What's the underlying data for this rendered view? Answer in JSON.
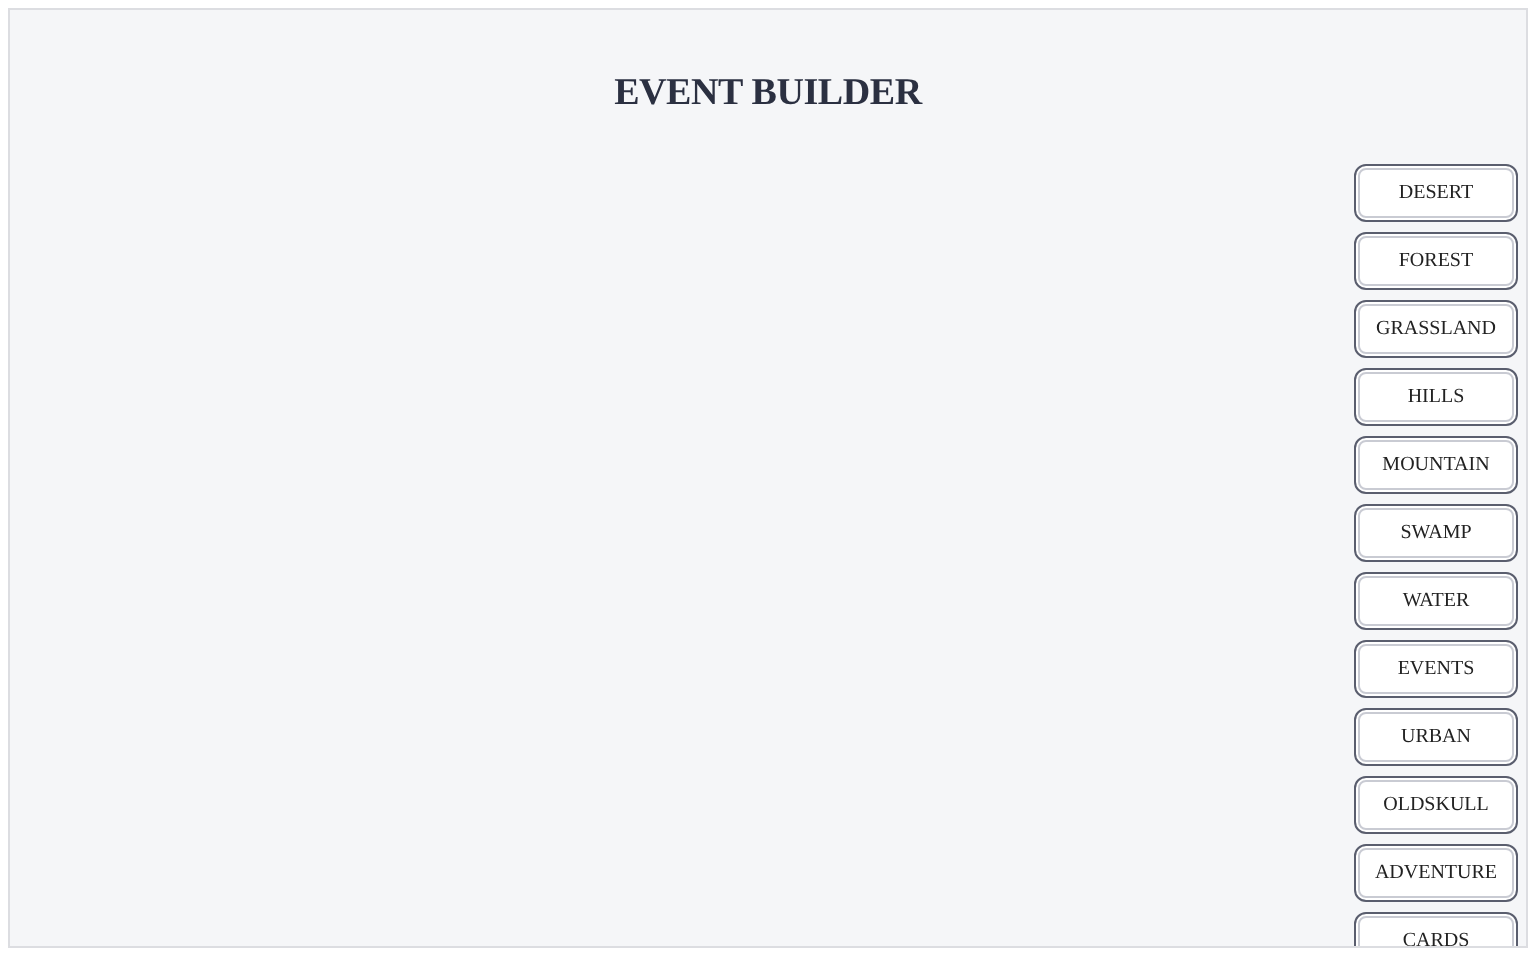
{
  "title": "EVENT BUILDER",
  "categories": [
    {
      "label": "DESERT"
    },
    {
      "label": "FOREST"
    },
    {
      "label": "GRASSLAND"
    },
    {
      "label": "HILLS"
    },
    {
      "label": "MOUNTAIN"
    },
    {
      "label": "SWAMP"
    },
    {
      "label": "WATER"
    },
    {
      "label": "EVENTS"
    },
    {
      "label": "URBAN"
    },
    {
      "label": "OLDSKULL"
    },
    {
      "label": "ADVENTURE"
    },
    {
      "label": "CARDS"
    }
  ]
}
